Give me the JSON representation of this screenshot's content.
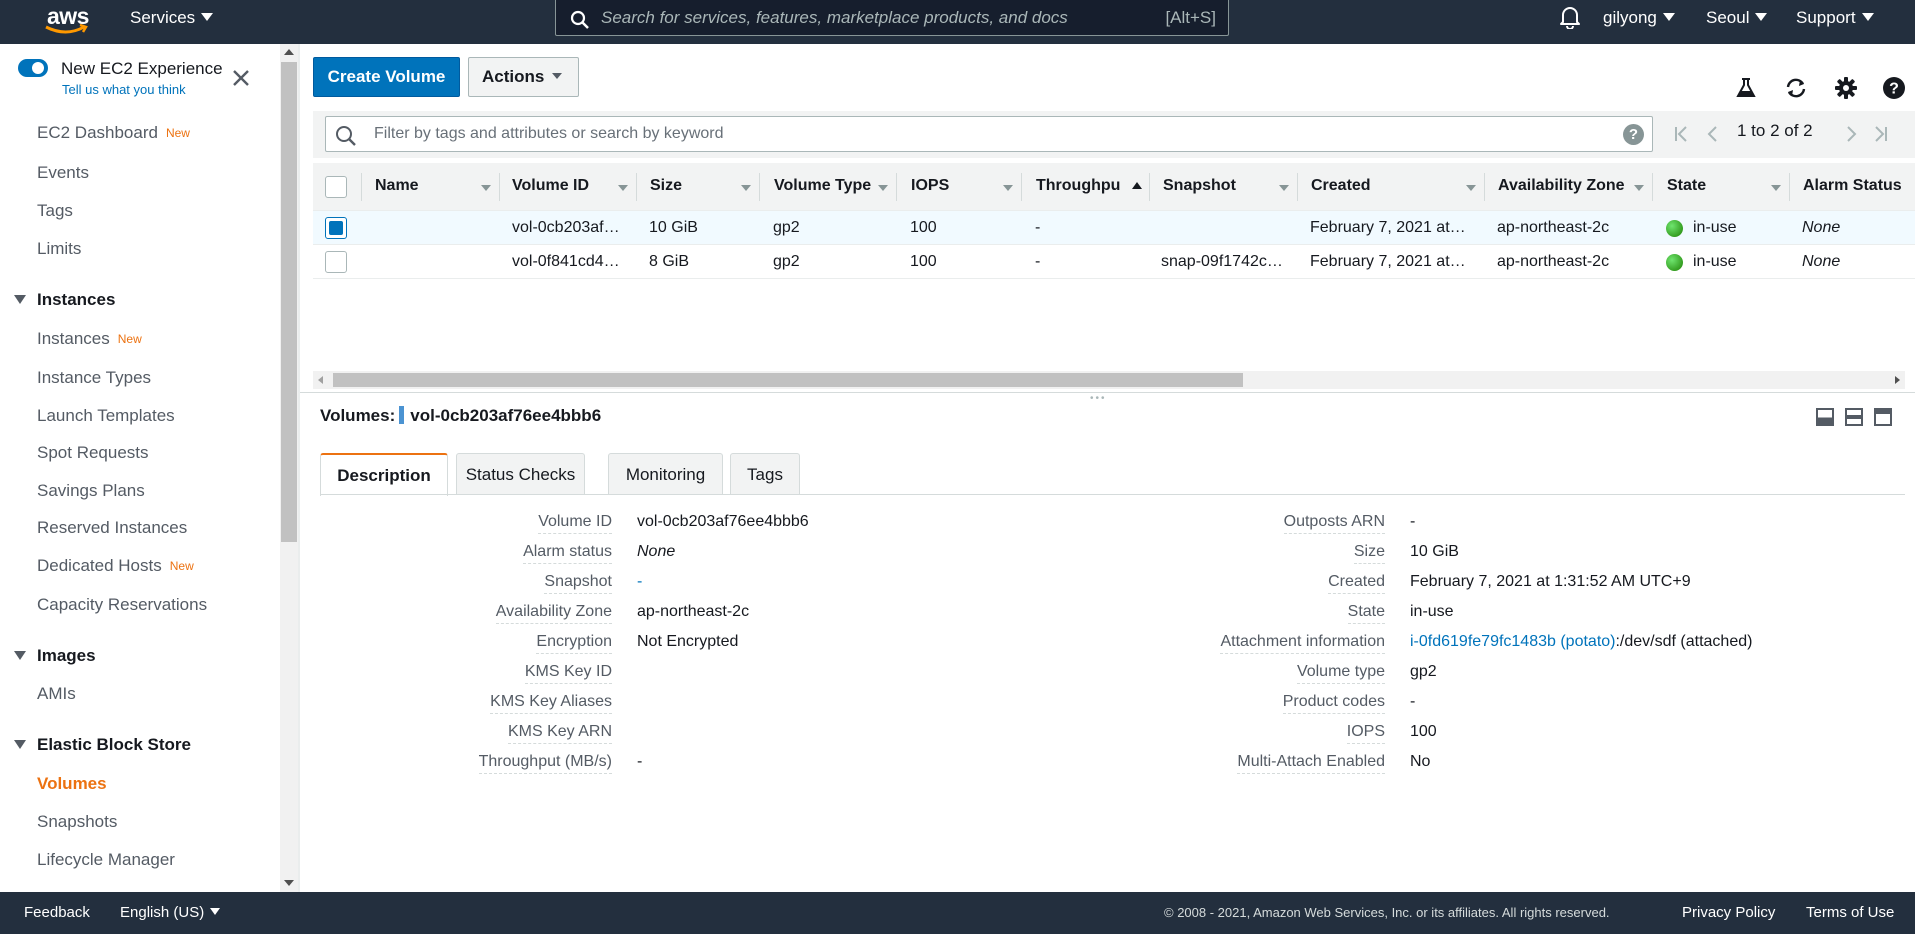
{
  "topnav": {
    "logo": "aws",
    "services": "Services",
    "search_placeholder": "Search for services, features, marketplace products, and docs",
    "search_shortcut": "[Alt+S]",
    "user": "gilyong",
    "region": "Seoul",
    "support": "Support"
  },
  "sidebar": {
    "new_experience_title": "New EC2 Experience",
    "new_experience_link": "Tell us what you think",
    "new_badge": "New",
    "items": {
      "dashboard": "EC2 Dashboard",
      "events": "Events",
      "tags": "Tags",
      "limits": "Limits",
      "instances_head": "Instances",
      "instances": "Instances",
      "instance_types": "Instance Types",
      "launch_templates": "Launch Templates",
      "spot_requests": "Spot Requests",
      "savings_plans": "Savings Plans",
      "reserved_instances": "Reserved Instances",
      "dedicated_hosts": "Dedicated Hosts",
      "capacity_reservations": "Capacity Reservations",
      "images_head": "Images",
      "amis": "AMIs",
      "ebs_head": "Elastic Block Store",
      "volumes": "Volumes",
      "snapshots": "Snapshots",
      "lifecycle_manager": "Lifecycle Manager"
    }
  },
  "toolbar": {
    "create_volume": "Create Volume",
    "actions": "Actions"
  },
  "filter": {
    "placeholder": "Filter by tags and attributes or search by keyword",
    "help": "?",
    "pager_text": "1 to 2 of 2"
  },
  "table": {
    "columns": [
      "Name",
      "Volume ID",
      "Size",
      "Volume Type",
      "IOPS",
      "Throughput",
      "Snapshot",
      "Created",
      "Availability Zone",
      "State",
      "Alarm Status"
    ],
    "rows": [
      {
        "name": "",
        "volume_id": "vol-0cb203af…",
        "size": "10 GiB",
        "type": "gp2",
        "iops": "100",
        "throughput": "-",
        "snapshot": "",
        "created": "February 7, 2021 at…",
        "az": "ap-northeast-2c",
        "state": "in-use",
        "alarm": "None"
      },
      {
        "name": "",
        "volume_id": "vol-0f841cd4…",
        "size": "8 GiB",
        "type": "gp2",
        "iops": "100",
        "throughput": "-",
        "snapshot": "snap-09f1742c…",
        "created": "February 7, 2021 at…",
        "az": "ap-northeast-2c",
        "state": "in-use",
        "alarm": "None"
      }
    ],
    "selected_row": 0
  },
  "detail": {
    "prefix": "Volumes:",
    "volume": "vol-0cb203af76ee4bbb6",
    "tabs": [
      "Description",
      "Status Checks",
      "Monitoring",
      "Tags"
    ],
    "active_tab": "Description",
    "left": [
      {
        "label": "Volume ID",
        "value": "vol-0cb203af76ee4bbb6"
      },
      {
        "label": "Alarm status",
        "value": "None"
      },
      {
        "label": "Snapshot",
        "value": "-"
      },
      {
        "label": "Availability Zone",
        "value": "ap-northeast-2c"
      },
      {
        "label": "Encryption",
        "value": "Not Encrypted"
      },
      {
        "label": "KMS Key ID",
        "value": ""
      },
      {
        "label": "KMS Key Aliases",
        "value": ""
      },
      {
        "label": "KMS Key ARN",
        "value": ""
      },
      {
        "label": "Throughput (MB/s)",
        "value": "-"
      }
    ],
    "right": [
      {
        "label": "Outposts ARN",
        "value": "-"
      },
      {
        "label": "Size",
        "value": "10 GiB"
      },
      {
        "label": "Created",
        "value": "February 7, 2021 at 1:31:52 AM UTC+9"
      },
      {
        "label": "State",
        "value": "in-use"
      },
      {
        "label": "Attachment information",
        "value": "i-0fd619fe79fc1483b (potato)",
        "value_suffix": ":/dev/sdf (attached)"
      },
      {
        "label": "Volume type",
        "value": "gp2"
      },
      {
        "label": "Product codes",
        "value": "-"
      },
      {
        "label": "IOPS",
        "value": "100"
      },
      {
        "label": "Multi-Attach Enabled",
        "value": "No"
      }
    ]
  },
  "footer": {
    "feedback": "Feedback",
    "language": "English (US)",
    "copyright": "© 2008 - 2021, Amazon Web Services, Inc. or its affiliates. All rights reserved.",
    "privacy": "Privacy Policy",
    "terms": "Terms of Use"
  },
  "colors": {
    "nav_bg": "#232f3e",
    "primary": "#0073bb",
    "active": "#ec7211",
    "status_ok": "#1d8102"
  }
}
